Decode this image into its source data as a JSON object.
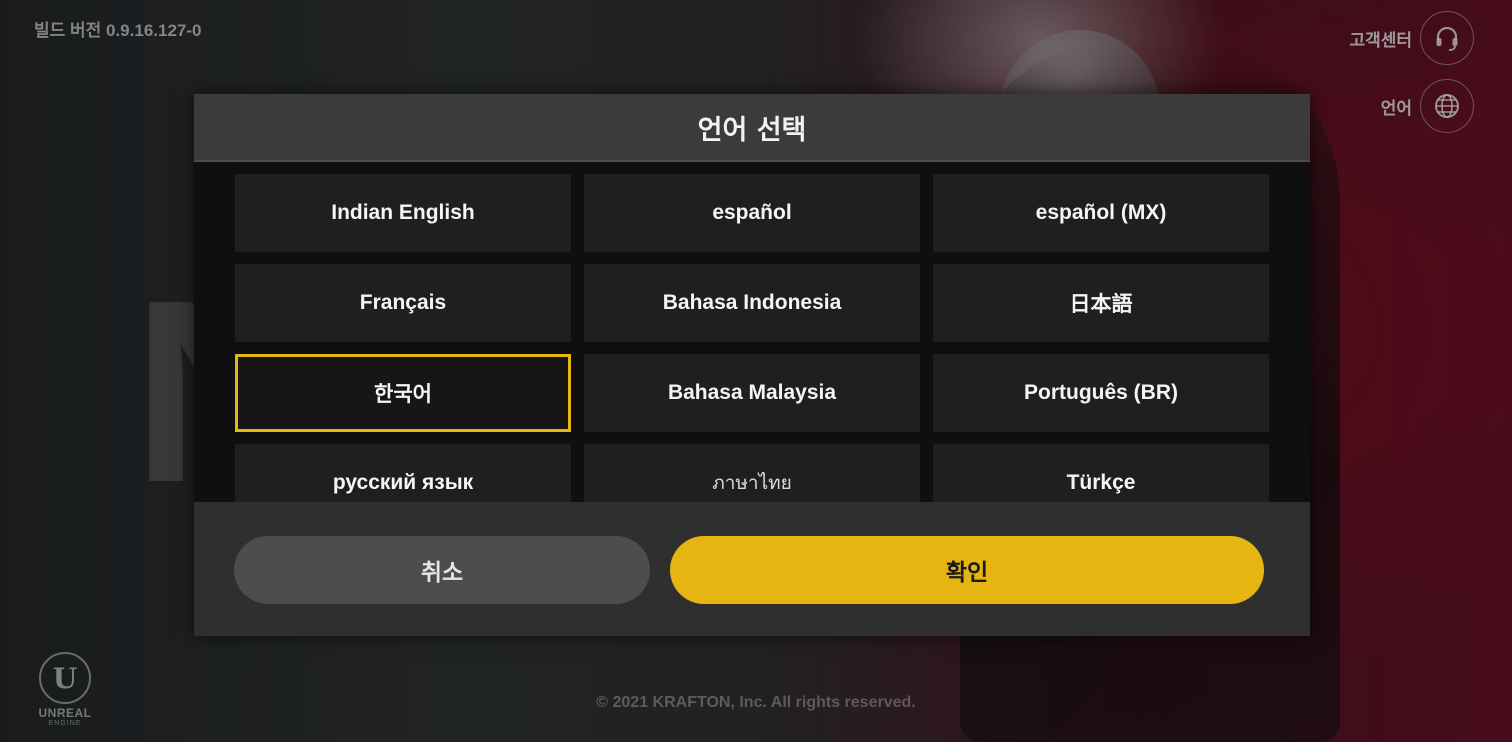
{
  "header": {
    "build_version": "빌드 버전  0.9.16.127-0",
    "support_label": "고객센터",
    "language_label": "언어"
  },
  "dialog": {
    "title": "언어 선택",
    "languages": [
      {
        "label": "Indian English"
      },
      {
        "label": "español"
      },
      {
        "label": "español (MX)"
      },
      {
        "label": "Français"
      },
      {
        "label": "Bahasa Indonesia"
      },
      {
        "label": "日本語"
      },
      {
        "label": "한국어",
        "selected": true
      },
      {
        "label": "Bahasa Malaysia"
      },
      {
        "label": "Português (BR)"
      },
      {
        "label": "русский язык"
      },
      {
        "label": "ภาษาไทย"
      },
      {
        "label": "Türkçe"
      }
    ],
    "cancel_label": "취소",
    "confirm_label": "확인"
  },
  "footer": {
    "copyright": "© 2021 KRAFTON, Inc. All rights reserved.",
    "engine_logo_text": "UNREAL",
    "engine_logo_subtext": "ENGINE"
  },
  "colors": {
    "accent": "#e6b511",
    "dialog_bg": "#0f0f0f",
    "header_bg": "#3b3b3b",
    "button_bg": "#1f1f1f"
  },
  "icons": {
    "support": "headset-icon",
    "language": "globe-icon",
    "engine": "unreal-engine-logo"
  }
}
